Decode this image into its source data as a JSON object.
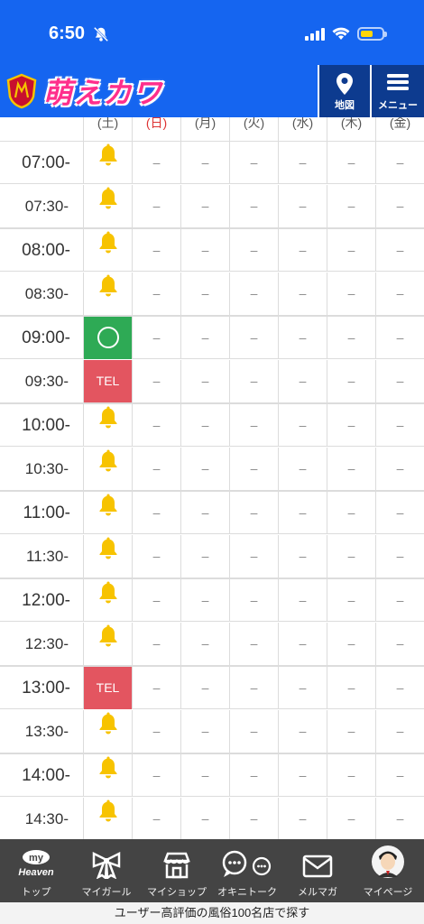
{
  "status_bar": {
    "time": "6:50"
  },
  "header": {
    "logo_text": "萌えカワ",
    "map_label": "地図",
    "menu_label": "メニュー"
  },
  "schedule": {
    "day_headers": [
      "(土)",
      "(日)",
      "(月)",
      "(火)",
      "(水)",
      "(木)",
      "(金)"
    ],
    "empty_mark": "–",
    "rows": [
      {
        "time": "07:00-",
        "sat": "bell",
        "hour": true
      },
      {
        "time": "07:30-",
        "sat": "bell",
        "hour": false
      },
      {
        "time": "08:00-",
        "sat": "bell",
        "hour": true
      },
      {
        "time": "08:30-",
        "sat": "bell",
        "hour": false
      },
      {
        "time": "09:00-",
        "sat": "available",
        "hour": true
      },
      {
        "time": "09:30-",
        "sat": "TEL",
        "hour": false
      },
      {
        "time": "10:00-",
        "sat": "bell",
        "hour": true
      },
      {
        "time": "10:30-",
        "sat": "bell",
        "hour": false
      },
      {
        "time": "11:00-",
        "sat": "bell",
        "hour": true
      },
      {
        "time": "11:30-",
        "sat": "bell",
        "hour": false
      },
      {
        "time": "12:00-",
        "sat": "bell",
        "hour": true
      },
      {
        "time": "12:30-",
        "sat": "bell",
        "hour": false
      },
      {
        "time": "13:00-",
        "sat": "TEL",
        "hour": true
      },
      {
        "time": "13:30-",
        "sat": "bell",
        "hour": false
      },
      {
        "time": "14:00-",
        "sat": "bell",
        "hour": true
      },
      {
        "time": "14:30-",
        "sat": "bell",
        "hour": false
      }
    ]
  },
  "bottom_nav": {
    "items": [
      {
        "label": "トップ",
        "icon": "my-heaven-icon",
        "badge": "my",
        "sub": "Heaven"
      },
      {
        "label": "マイガール",
        "icon": "ribbon-icon"
      },
      {
        "label": "マイショップ",
        "icon": "shop-icon"
      },
      {
        "label": "オキニトーク",
        "icon": "chat-icon"
      },
      {
        "label": "メルマガ",
        "icon": "mail-icon"
      },
      {
        "label": "マイページ",
        "icon": "avatar-icon"
      }
    ]
  },
  "footer": {
    "text": "ユーザー高評価の風俗100名店で探す"
  },
  "colors": {
    "brand_blue": "#1565f0",
    "available_green": "#2eaa55",
    "tel_red": "#e35560",
    "bell_yellow": "#f7c300"
  }
}
